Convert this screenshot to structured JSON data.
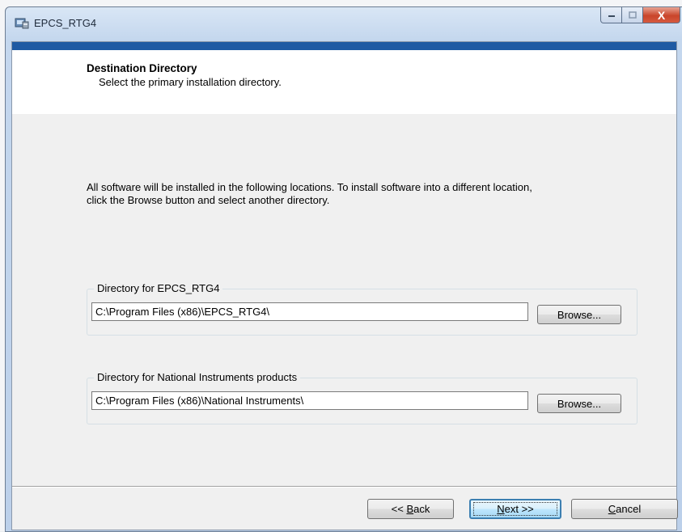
{
  "window": {
    "title": "EPCS_RTG4",
    "close_glyph": "X"
  },
  "header": {
    "title": "Destination Directory",
    "subtitle": "Select the primary installation directory."
  },
  "body": {
    "description": "All software will be installed in the following locations. To install software into a different location, click the Browse button and select another directory."
  },
  "directories": [
    {
      "legend": "Directory for EPCS_RTG4",
      "value": "C:\\Program Files (x86)\\EPCS_RTG4\\",
      "browse_label": "Browse..."
    },
    {
      "legend": "Directory for National Instruments products",
      "value": "C:\\Program Files (x86)\\National Instruments\\",
      "browse_label": "Browse..."
    }
  ],
  "buttons": {
    "back_prefix": "<< ",
    "back_mnemonic": "B",
    "back_rest": "ack",
    "next_mnemonic": "N",
    "next_rest": "ext >>",
    "cancel_mnemonic": "C",
    "cancel_rest": "ancel"
  },
  "colors": {
    "accent": "#1f5aa3",
    "close": "#c9452b"
  }
}
